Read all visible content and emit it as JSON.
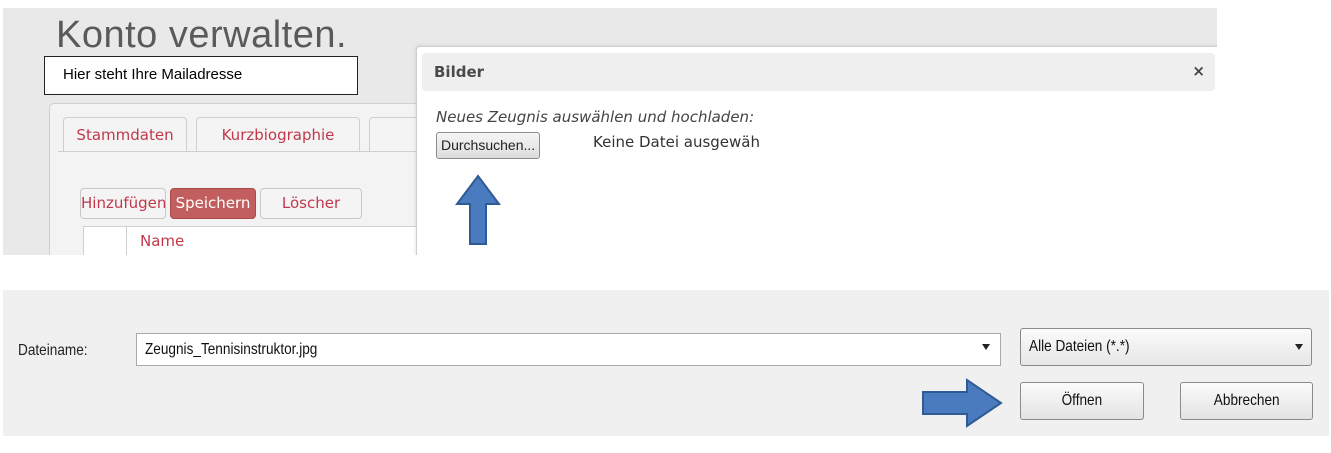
{
  "top_screen": {
    "page_title": "Konto verwalten.",
    "email_label": "Hier steht Ihre Mailadresse",
    "tabs": [
      {
        "label": "Stammdaten"
      },
      {
        "label": "Kurzbiographie"
      }
    ],
    "toolbar": {
      "add_label": "Hinzufügen",
      "save_label": "Speichern",
      "delete_label": "Löscher"
    },
    "grid": {
      "column_name": "Name"
    },
    "dialog": {
      "title": "Bilder",
      "close_symbol": "×",
      "upload_prompt": "Neues Zeugnis auswählen und hochladen:",
      "browse_label": "Durchsuchen...",
      "no_file_text": "Keine Datei ausgewäh"
    }
  },
  "file_dialog": {
    "filename_label": "Dateiname:",
    "filename_value": "Zeugnis_Tennisinstruktor.jpg",
    "filetype_value": "Alle Dateien (*.*)",
    "open_label": "Öffnen",
    "cancel_label": "Abbrechen"
  },
  "annotations": {
    "arrow_color": "#4a7bbf",
    "arrow_outline": "#2f5a95"
  }
}
